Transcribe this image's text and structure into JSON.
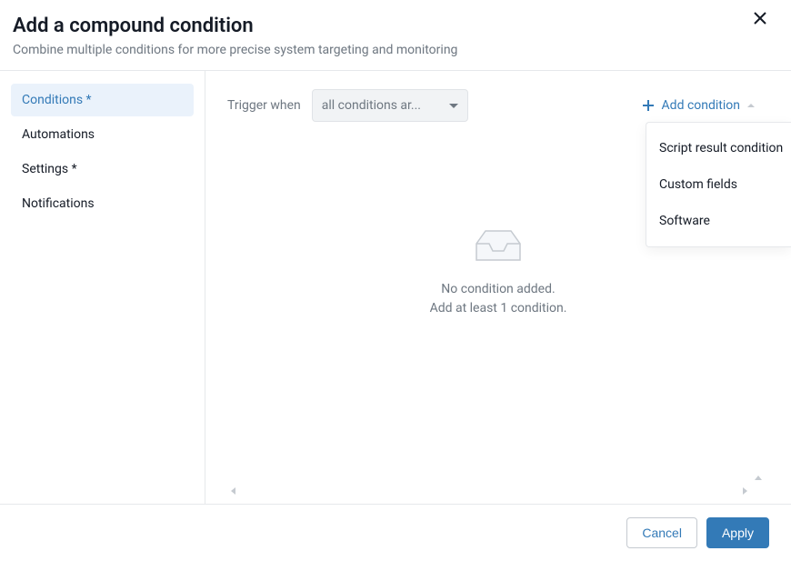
{
  "header": {
    "title": "Add a compound condition",
    "subtitle": "Combine multiple conditions for more precise system targeting and monitoring"
  },
  "sidebar": {
    "items": [
      {
        "label": "Conditions *",
        "active": true
      },
      {
        "label": "Automations",
        "active": false
      },
      {
        "label": "Settings *",
        "active": false
      },
      {
        "label": "Notifications",
        "active": false
      }
    ]
  },
  "toolbar": {
    "trigger_label": "Trigger when",
    "select_value": "all conditions ar...",
    "add_condition_label": "Add condition"
  },
  "dropdown": {
    "items": [
      {
        "label": "Script result condition"
      },
      {
        "label": "Custom fields"
      },
      {
        "label": "Software"
      }
    ]
  },
  "empty_state": {
    "line1": "No condition added.",
    "line2": "Add at least 1 condition."
  },
  "footer": {
    "cancel_label": "Cancel",
    "apply_label": "Apply"
  }
}
